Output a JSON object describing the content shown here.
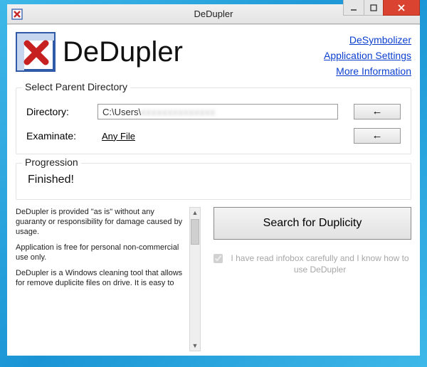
{
  "window": {
    "title": "DeDupler"
  },
  "header": {
    "app_name": "DeDupler",
    "links": {
      "desymbolizer": "DeSymbolizer",
      "settings": "Application Settings",
      "more_info": "More Information"
    }
  },
  "select_group": {
    "title": "Select Parent Directory",
    "directory_label": "Directory:",
    "directory_value_prefix": "C:\\Users\\",
    "directory_value_blurred": "xxxxxxxxxxxxxx",
    "examinate_label": "Examinate:",
    "any_file_label": "Any File",
    "browse_arrow": "←"
  },
  "progress_group": {
    "title": "Progression",
    "status": "Finished!"
  },
  "infobox": {
    "p1": "DeDupler is provided \"as is\" without any guaranty or responsibility for damage caused by usage.",
    "p2": "Application is free for personal non-commercial use only.",
    "p3": "DeDupler is a Windows cleaning tool that allows for remove duplicite files on drive. It is easy to"
  },
  "actions": {
    "search_label": "Search for Duplicity",
    "confirm_text": "I have read infobox carefully and I know how to use DeDupler",
    "confirm_checked": true
  }
}
